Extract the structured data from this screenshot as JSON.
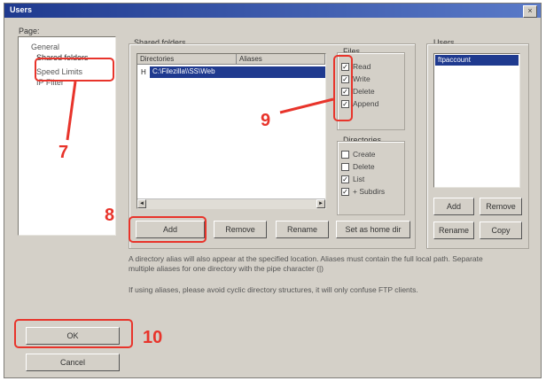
{
  "window": {
    "title": "Users",
    "close_glyph": "×"
  },
  "page": {
    "label": "Page:",
    "items": [
      "General",
      "Shared folders",
      "Speed Limits",
      "IP Filter"
    ]
  },
  "shared_folders": {
    "group_label": "Shared folders",
    "columns": [
      "Directories",
      "Aliases"
    ],
    "rows": [
      {
        "marker": "H",
        "path": "C:\\Filezilla\\\\SS\\Web"
      }
    ],
    "scroll_left": "◄",
    "scroll_right": "►"
  },
  "files": {
    "label": "Files",
    "options": [
      {
        "label": "Read",
        "checked": true
      },
      {
        "label": "Write",
        "checked": true
      },
      {
        "label": "Delete",
        "checked": true
      },
      {
        "label": "Append",
        "checked": true
      }
    ]
  },
  "directories": {
    "label": "Directories",
    "options": [
      {
        "label": "Create",
        "checked": false
      },
      {
        "label": "Delete",
        "checked": false
      },
      {
        "label": "List",
        "checked": true
      },
      {
        "label": "+ Subdirs",
        "checked": true
      }
    ]
  },
  "folder_buttons": {
    "add": "Add",
    "remove": "Remove",
    "rename": "Rename",
    "set_home": "Set as home dir"
  },
  "users": {
    "label": "Users",
    "items": [
      "ftpaccount"
    ],
    "buttons": {
      "add": "Add",
      "remove": "Remove",
      "rename": "Rename",
      "copy": "Copy"
    }
  },
  "info": {
    "line1": "A directory alias will also appear at the specified location. Aliases must contain the full local path. Separate multiple aliases for one directory with the pipe character (|)",
    "line2": "If using aliases, please avoid cyclic directory structures, it will only confuse FTP clients."
  },
  "dialog_buttons": {
    "ok": "OK",
    "cancel": "Cancel"
  },
  "annotations": {
    "n7": "7",
    "n8": "8",
    "n9": "9",
    "n10": "10",
    "color": "#e8342b"
  },
  "checkmark": "✓"
}
